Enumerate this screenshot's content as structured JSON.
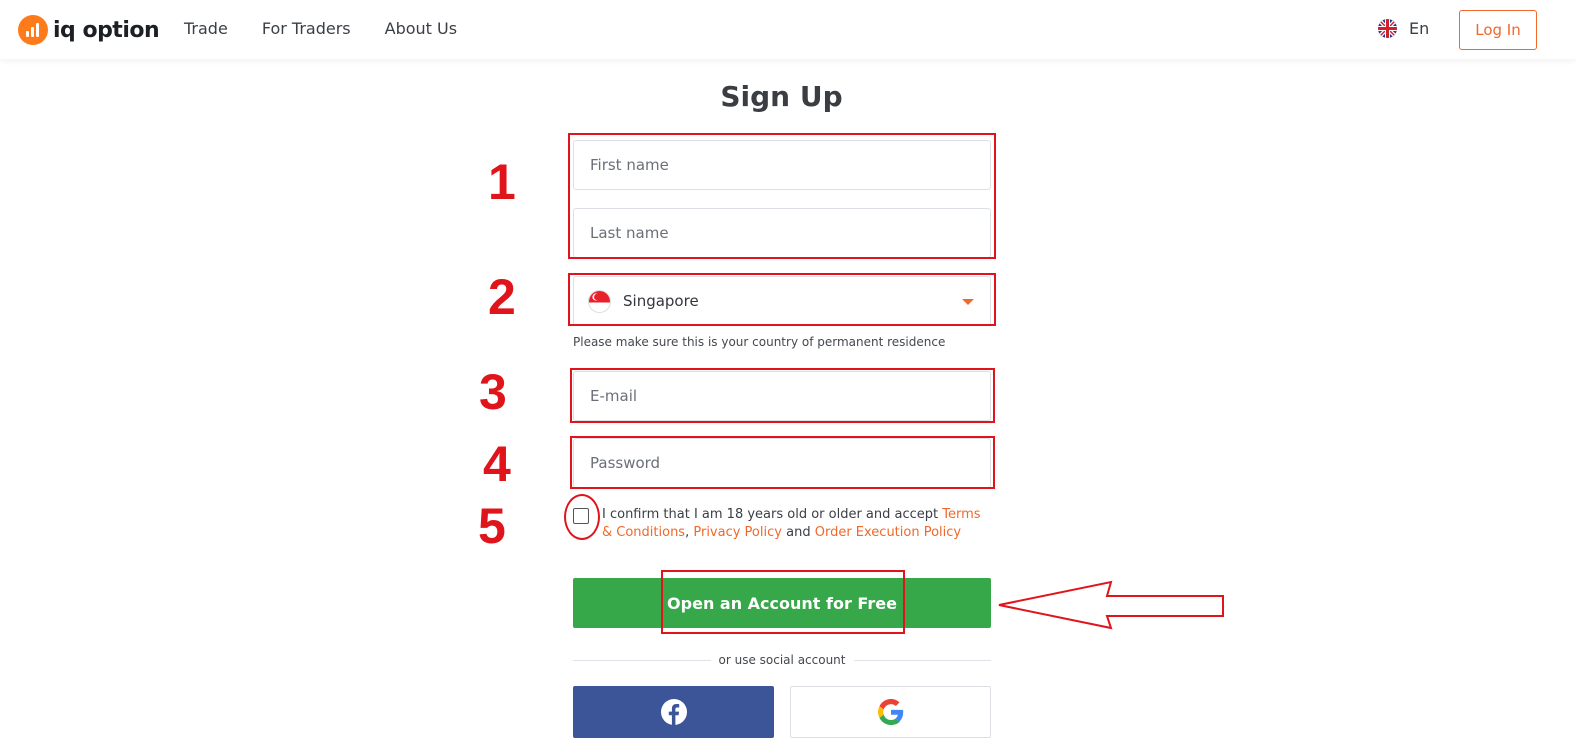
{
  "header": {
    "logo_text": "iq option",
    "nav": [
      "Trade",
      "For Traders",
      "About Us"
    ],
    "language": "En",
    "login_label": "Log In"
  },
  "form": {
    "title": "Sign Up",
    "first_name_placeholder": "First name",
    "last_name_placeholder": "Last name",
    "country": "Singapore",
    "country_hint": "Please make sure this is your country of permanent residence",
    "email_placeholder": "E-mail",
    "password_placeholder": "Password",
    "consent_text": "I confirm that I am 18 years old or older and accept",
    "terms_link": "Terms & Conditions",
    "comma": ",",
    "privacy_link": "Privacy Policy",
    "and_text": "and",
    "order_link": "Order Execution Policy",
    "submit_label": "Open an Account for Free",
    "social_divider": "or use social account"
  },
  "annotations": [
    "1",
    "2",
    "3",
    "4",
    "5"
  ],
  "colors": {
    "accent": "#f0682a",
    "cta": "#37a84a",
    "facebook": "#3b5598",
    "annotation": "#e0141b"
  },
  "icons": [
    "iq-option-logo-icon",
    "uk-flag-icon",
    "singapore-flag-icon",
    "dropdown-caret-icon",
    "facebook-icon",
    "google-icon"
  ]
}
